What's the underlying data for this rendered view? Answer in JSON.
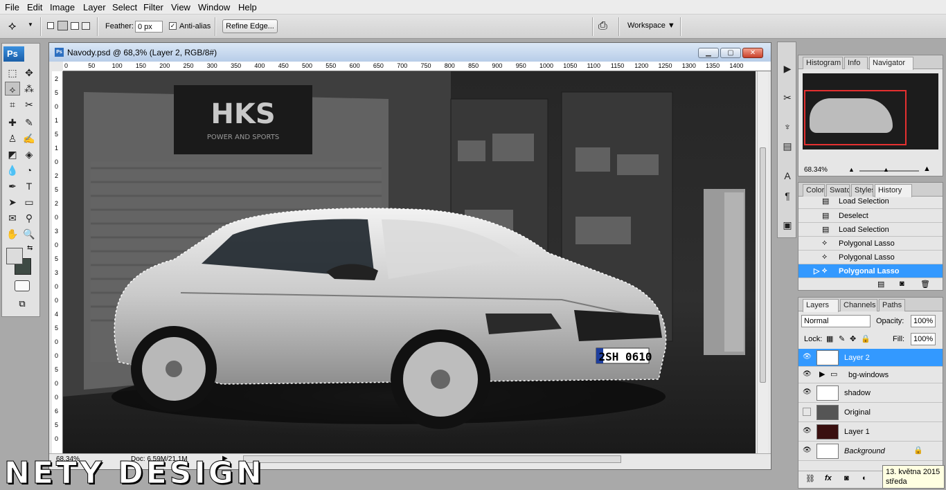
{
  "menu": [
    "File",
    "Edit",
    "Image",
    "Layer",
    "Select",
    "Filter",
    "View",
    "Window",
    "Help"
  ],
  "options": {
    "feather_label": "Feather:",
    "feather_value": "0 px",
    "antialias_label": "Anti-alias",
    "refine_edge": "Refine Edge...",
    "workspace": "Workspace ▼"
  },
  "toolbox": {
    "logo": "Ps"
  },
  "document": {
    "title": "Navody.psd @ 68,3% (Layer 2, RGB/8#)",
    "ruler_h": [
      "0",
      "50",
      "100",
      "150",
      "200",
      "250",
      "300",
      "350",
      "400",
      "450",
      "500",
      "550",
      "600",
      "650",
      "700",
      "750",
      "800",
      "850",
      "900",
      "950",
      "1000",
      "1050",
      "1100",
      "1150",
      "1200",
      "1250",
      "1300",
      "1350",
      "1400"
    ],
    "ruler_v": [
      "2",
      "5",
      "0",
      "1",
      "5",
      "1",
      "0",
      "2",
      "5",
      "2",
      "0",
      "3",
      "0",
      "5",
      "3",
      "0",
      "0",
      "4",
      "5",
      "0",
      "0",
      "5",
      "0",
      "0",
      "6",
      "5",
      "0"
    ],
    "zoom": "68,34%",
    "doc_size": "Doc: 6,59M/21,1M",
    "poster_text": "HKS",
    "poster_sub": "POWER AND SPORTS",
    "plate": "2SH 0610"
  },
  "navigator": {
    "tabs": [
      "Histogram",
      "Info",
      "Navigator"
    ],
    "zoom": "68.34%"
  },
  "history": {
    "tabs": [
      "Color",
      "Swatc",
      "Styles",
      "History"
    ],
    "items": [
      "Load Selection",
      "Deselect",
      "Load Selection",
      "Polygonal Lasso",
      "Polygonal Lasso",
      "Polygonal Lasso"
    ]
  },
  "layers": {
    "tabs": [
      "Layers",
      "Channels",
      "Paths"
    ],
    "blend_mode": "Normal",
    "opacity_label": "Opacity:",
    "opacity": "100%",
    "lock_label": "Lock:",
    "fill_label": "Fill:",
    "fill": "100%",
    "items": [
      "Layer 2",
      "bg-windows",
      "shadow",
      "Original",
      "Layer 1",
      "Background"
    ]
  },
  "watermark": "NETY DESIGN",
  "tooltip": {
    "date": "13. května 2015",
    "day": "středa"
  },
  "colors": {
    "accent": "#3399ff",
    "selection_blue": "#3e8ee8"
  }
}
